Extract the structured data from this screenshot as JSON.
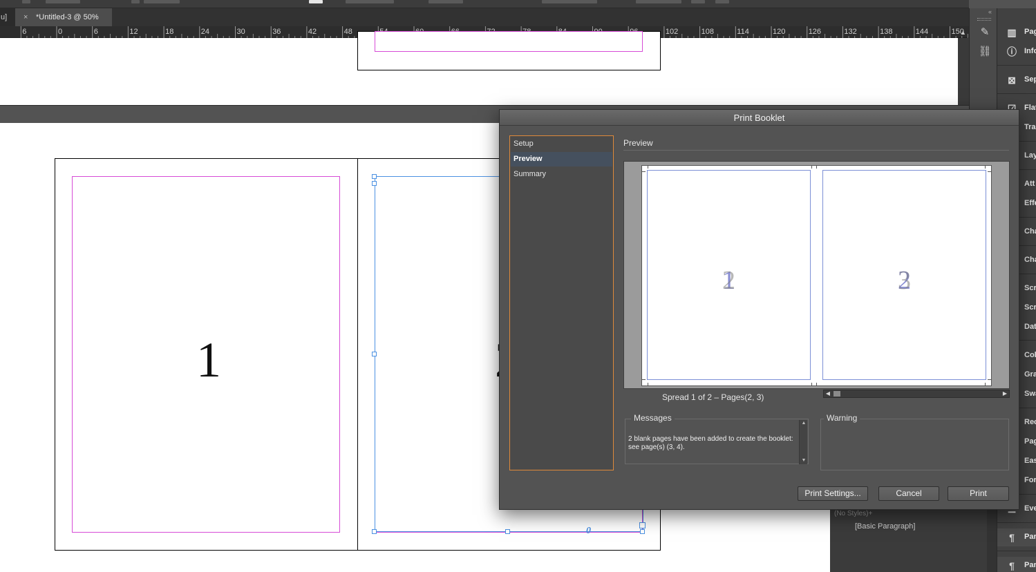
{
  "app": {
    "prev_tab_fragment": "u]",
    "active_tab": "*Untitled-3 @ 50%",
    "tab_close": "×"
  },
  "ruler": {
    "labels": [
      "6",
      "0",
      "6",
      "12",
      "18",
      "24",
      "30",
      "36",
      "42",
      "48",
      "54",
      "60",
      "66",
      "72",
      "78",
      "84",
      "90",
      "96",
      "102",
      "108",
      "114",
      "120",
      "126",
      "132",
      "138",
      "144",
      "150"
    ]
  },
  "document": {
    "page1_number": "1",
    "page2_number_fragment": "2",
    "frame_overset_marker": "0",
    "colors": {
      "margin": "#d64ad6",
      "frame": "#4a90e2"
    }
  },
  "side_panels": {
    "items": [
      {
        "icon": "pages-icon",
        "label": "Pag"
      },
      {
        "icon": "info-icon",
        "label": "Info"
      },
      {
        "icon": "separations-icon",
        "label": "Sep"
      },
      {
        "icon": "flattener-icon",
        "label": "Flat"
      },
      {
        "icon": "trap-icon",
        "label": "Tra"
      },
      {
        "icon": "layers-icon",
        "label": "Lay"
      },
      {
        "icon": "attributes-icon",
        "label": "Att"
      },
      {
        "icon": "effects-icon",
        "label": "Effe"
      },
      {
        "icon": "character-icon",
        "label": "Cha"
      },
      {
        "icon": "character-styles-icon",
        "label": "Cha"
      },
      {
        "icon": "scripts-icon",
        "label": "Scr"
      },
      {
        "icon": "script-label-icon",
        "label": "Scr"
      },
      {
        "icon": "data-merge-icon",
        "label": "Dat"
      },
      {
        "icon": "color-icon",
        "label": "Col"
      },
      {
        "icon": "gradient-icon",
        "label": "Gra"
      },
      {
        "icon": "swatches-icon",
        "label": "Swa"
      },
      {
        "icon": "references-icon",
        "label": "Rec"
      },
      {
        "icon": "pages-2-icon",
        "label": "Pag"
      },
      {
        "icon": "ease-icon",
        "label": "Eas"
      },
      {
        "icon": "form-icon",
        "label": "For"
      },
      {
        "icon": "events-icon",
        "label": "Eve"
      },
      {
        "icon": "paragraph-icon",
        "label": "Par"
      },
      {
        "icon": "paragraph-styles-icon",
        "label": "Par"
      }
    ],
    "para_styles_partial": "(No Styles)+",
    "para_styles_item": "[Basic Paragraph]"
  },
  "dialog": {
    "title": "Print Booklet",
    "nav": [
      "Setup",
      "Preview",
      "Summary"
    ],
    "selected_nav": "Preview",
    "section_heading": "Preview",
    "preview": {
      "left_page": "1",
      "left_page_ghost": "2",
      "right_page": "2",
      "right_page_ghost": "3"
    },
    "spread_label": "Spread 1 of 2 – Pages(2, 3)",
    "messages": {
      "legend": "Messages",
      "text": "2 blank pages have been added to create the booklet: see page(s) (3, 4)."
    },
    "warning": {
      "legend": "Warning",
      "text": ""
    },
    "buttons": {
      "print_settings": "Print Settings...",
      "cancel": "Cancel",
      "print": "Print"
    }
  }
}
